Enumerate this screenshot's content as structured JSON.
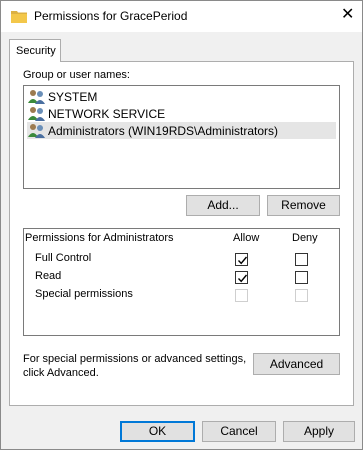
{
  "window": {
    "title": "Permissions for GracePeriod",
    "close_glyph": "✕"
  },
  "tabs": [
    {
      "label": "Security"
    }
  ],
  "group_section": {
    "label": "Group or user names:",
    "users": [
      {
        "name": "SYSTEM",
        "icon": "users-icon",
        "selected": false
      },
      {
        "name": "NETWORK SERVICE",
        "icon": "users-icon",
        "selected": false
      },
      {
        "name": "Administrators (WIN19RDS\\Administrators)",
        "icon": "users-icon",
        "selected": true
      }
    ],
    "add_label": "Add...",
    "remove_label": "Remove"
  },
  "permissions": {
    "header_label": "Permissions for Administrators",
    "allow_label": "Allow",
    "deny_label": "Deny",
    "rows": [
      {
        "name": "Full Control",
        "allow": true,
        "deny": false,
        "enabled": true
      },
      {
        "name": "Read",
        "allow": true,
        "deny": false,
        "enabled": true
      },
      {
        "name": "Special permissions",
        "allow": false,
        "deny": false,
        "enabled": false
      }
    ]
  },
  "advanced": {
    "text": "For special permissions or advanced settings, click Advanced.",
    "line1": "For special permissions or advanced settings,",
    "line2": "click Advanced.",
    "button_label": "Advanced"
  },
  "footer": {
    "ok_label": "OK",
    "cancel_label": "Cancel",
    "apply_label": "Apply"
  },
  "colors": {
    "accent": "#0078d7",
    "highlight": "#ffff33",
    "folder": "#f3c74a"
  }
}
